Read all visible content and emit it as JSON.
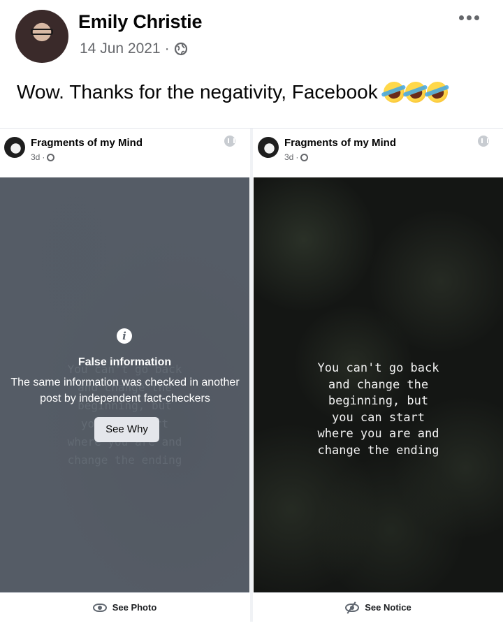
{
  "post": {
    "author": "Emily Christie",
    "date": "14 Jun 2021",
    "separator": "·",
    "text": "Wow. Thanks for the negativity, Facebook",
    "emoji_count": 3
  },
  "left_panel": {
    "page_name": "Fragments of my Mind",
    "age": "3d",
    "separator": "·",
    "quote": "You can't go back\nand change the\nbeginning, but\nyou can start\nwhere you are and\nchange the ending",
    "warning_title": "False information",
    "warning_body": "The same information was checked in another post by independent fact-checkers",
    "see_why": "See Why",
    "footer": "See Photo"
  },
  "right_panel": {
    "page_name": "Fragments of my Mind",
    "age": "3d",
    "separator": "·",
    "quote": "You can't go back\nand change the\nbeginning, but\nyou can start\nwhere you are and\nchange the ending",
    "footer": "See Notice"
  },
  "icons": {
    "more": "more-options-icon",
    "privacy": "globe-icon",
    "info": "info-icon",
    "see_photo": "eye-icon",
    "see_notice": "eye-off-icon"
  }
}
